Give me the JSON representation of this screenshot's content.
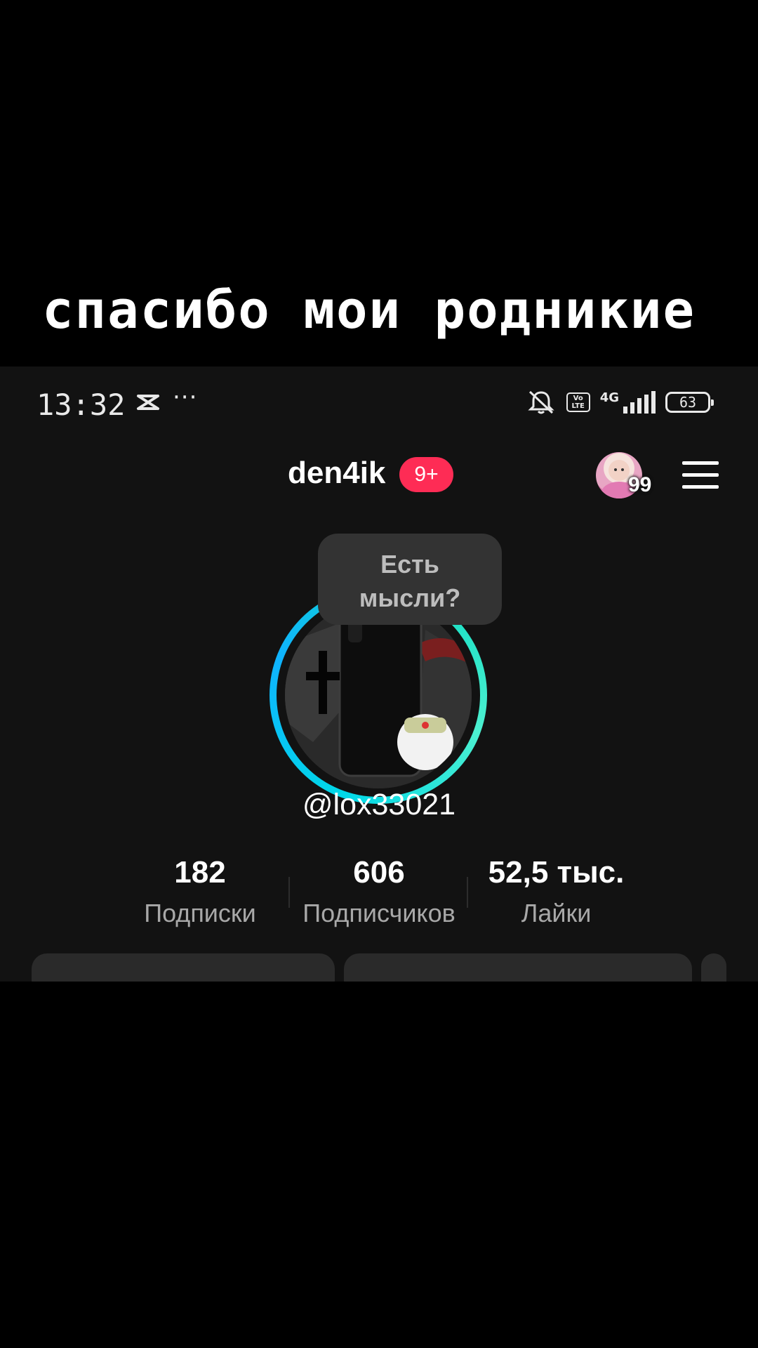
{
  "caption": "спасибо мои родникие",
  "status_bar": {
    "time": "13:32",
    "more": "···",
    "volte": "Vo LTE",
    "network": "4G",
    "battery": "63",
    "icons": [
      "capcut-icon",
      "mute-icon",
      "volte-icon",
      "signal-icon",
      "battery-icon"
    ]
  },
  "header": {
    "title": "den4ik",
    "badge": "9+",
    "friends_count": "99",
    "icons": [
      "friend-avatar",
      "menu-icon"
    ]
  },
  "profile": {
    "bubble_line1": "Есть",
    "bubble_line2": "мысли?",
    "username": "@lox33021"
  },
  "stats": [
    {
      "value": "182",
      "label": "Подписки"
    },
    {
      "value": "606",
      "label": "Подписчиков"
    },
    {
      "value": "52,5 тыс.",
      "label": "Лайки"
    }
  ],
  "colors": {
    "background": "#121212",
    "badge": "#fe2c55",
    "ring": "#00d8e8",
    "add_button": "#20d5ec",
    "secondary_text": "#a8a8a8"
  }
}
